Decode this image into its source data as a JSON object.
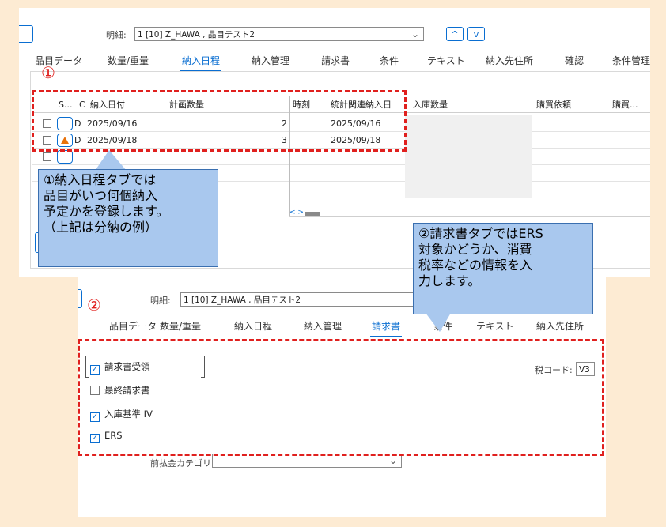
{
  "panel1": {
    "detail_label": "明細:",
    "detail_value": "1 [10] Z_HAWA , 品目テスト2",
    "up_symbol": "^",
    "down_symbol": "v",
    "tabs": [
      "品目データ",
      "数量/重量",
      "納入日程",
      "納入管理",
      "請求書",
      "条件",
      "テキスト",
      "納入先住所",
      "確認",
      "条件管理"
    ],
    "active_tab": "納入日程",
    "marker": "①",
    "columns": [
      "S...",
      "C",
      "納入日付",
      "計画数量",
      "時刻",
      "統計関連納入日",
      "入庫数量",
      "購買依頼",
      "購買..."
    ],
    "rows": [
      {
        "c": "D",
        "date": "2025/09/16",
        "qty": "2",
        "stat_date": "2025/09/16"
      },
      {
        "c": "D",
        "date": "2025/09/18",
        "qty": "3",
        "stat_date": "2025/09/18"
      }
    ],
    "scroll_arrows": "< >"
  },
  "callout1": {
    "lines": [
      "①納入日程タブでは",
      "品目がいつ何個納入",
      "予定かを登録します。",
      "（上記は分納の例）"
    ]
  },
  "callout2": {
    "lines": [
      "②請求書タブではERS",
      "対象かどうか、消費",
      "税率などの情報を入",
      "力します。"
    ]
  },
  "panel2": {
    "marker": "②",
    "detail_label": "明細:",
    "detail_value": "1 [10] Z_HAWA , 品目テスト2",
    "tabs": [
      "品目データ",
      "数量/重量",
      "納入日程",
      "納入管理",
      "請求書",
      "条件",
      "テキスト",
      "納入先住所"
    ],
    "active_tab": "請求書",
    "checkboxes": [
      {
        "label": "請求書受領",
        "checked": true
      },
      {
        "label": "最終請求書",
        "checked": false
      },
      {
        "label": "入庫基準 IV",
        "checked": true
      },
      {
        "label": "ERS",
        "checked": true
      }
    ],
    "tax_label": "税コード:",
    "tax_value": "V3",
    "prepay_label": "前払金カテゴリ"
  },
  "colors": {
    "accent": "#0a6ed1",
    "annotation": "#e0201e",
    "callout": "#a9c8ee",
    "background": "#fdebd3",
    "warning": "#e8710a"
  }
}
